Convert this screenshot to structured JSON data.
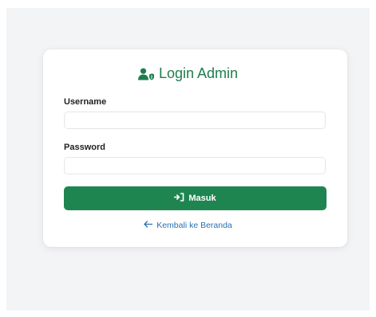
{
  "login_card": {
    "title": "Login Admin",
    "title_icon": "user-shield-icon",
    "username_label": "Username",
    "username_value": "",
    "password_label": "Password",
    "password_value": "",
    "submit_label": "Masuk",
    "submit_icon": "sign-in-icon",
    "back_label": "Kembali ke Beranda",
    "back_icon": "arrow-left-icon"
  },
  "colors": {
    "primary_green": "#1e8551",
    "title_green": "#1e7d4c",
    "link_blue": "#2a6fb5",
    "page_background": "#f3f4f6"
  }
}
